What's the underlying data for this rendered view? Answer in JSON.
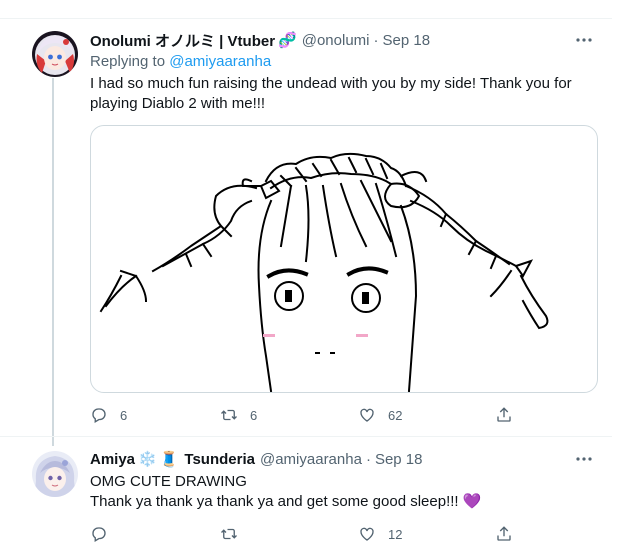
{
  "tweets": [
    {
      "author_name": "Onolumi オノルミ | Vtuber",
      "author_emoji": "🧬",
      "handle": "@onolumi",
      "date": "Sep 18",
      "replying_prefix": "Replying to",
      "replying_to": "@amiyaaranha",
      "text_lines": [
        "I had so much fun raising the undead with you by my side! Thank you for",
        "playing Diablo 2 with me!!!"
      ],
      "replies": "6",
      "retweets": "6",
      "likes": "62"
    },
    {
      "author_name": "Amiya",
      "author_emoji_a": "❄️",
      "author_emoji_b": "🧵",
      "author_name_b": "Tsunderia",
      "handle": "@amiyaaranha",
      "date": "Sep 18",
      "text_lines": [
        "OMG CUTE DRAWING",
        "Thank ya thank ya thank ya and get some good sleep!!! 💜"
      ],
      "replies": "",
      "retweets": "",
      "likes": "12"
    }
  ],
  "colors": {
    "accent": "#1d9bf0",
    "text": "#0f1419",
    "muted": "#536471",
    "border": "#cfd9de"
  },
  "icons": [
    "more-icon",
    "reply-icon",
    "retweet-icon",
    "like-icon",
    "share-icon"
  ]
}
